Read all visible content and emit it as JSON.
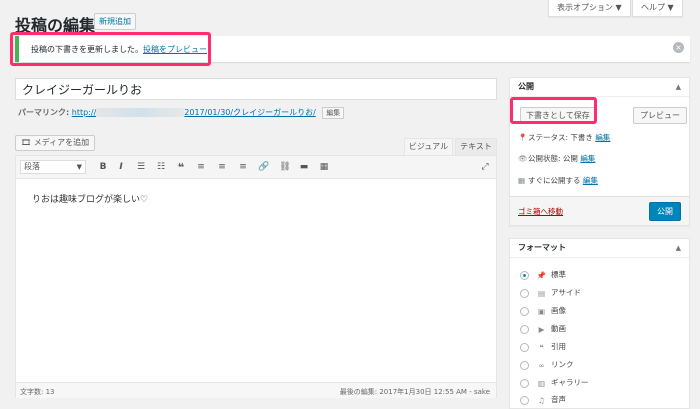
{
  "header": {
    "title": "投稿の編集",
    "new_button": "新規追加",
    "screen_options": "表示オプション ▼",
    "help": "ヘルプ ▼"
  },
  "notice": {
    "text": "投稿の下書きを更新しました。",
    "link": "投稿をプレビュー",
    "close": "×"
  },
  "post": {
    "title": "クレイジーガールりお",
    "permalink_label": "パーマリンク:",
    "permalink_prefix": "http://",
    "permalink_suffix": "2017/01/30/クレイジーガールりお/",
    "permalink_edit": "編集"
  },
  "editor": {
    "media_button": "メディアを追加",
    "tab_visual": "ビジュアル",
    "tab_text": "テキスト",
    "format_select": "段落",
    "content": "りおは趣味ブログが楽しい♡",
    "word_count": "文字数: 13",
    "last_edit": "最後の編集: 2017年1月30日 12:55 AM - sake",
    "toolbar_icons": [
      "bold-icon",
      "italic-icon",
      "bulleted-list-icon",
      "numbered-list-icon",
      "blockquote-icon",
      "align-left-icon",
      "align-center-icon",
      "align-right-icon",
      "link-icon",
      "unlink-icon",
      "read-more-icon",
      "toolbar-toggle-icon"
    ]
  },
  "publish": {
    "title": "公開",
    "save_draft": "下書きとして保存",
    "preview": "プレビュー",
    "status_label": "ステータス: 下書き",
    "status_edit": "編集",
    "visibility_label": "公開状態: 公開",
    "visibility_edit": "編集",
    "schedule_label": "すぐに公開する",
    "schedule_edit": "編集",
    "trash": "ゴミ箱へ移動",
    "publish_button": "公開"
  },
  "format_box": {
    "title": "フォーマット",
    "items": [
      {
        "label": "標準",
        "icon": "pin-icon",
        "checked": true
      },
      {
        "label": "アサイド",
        "icon": "aside-icon",
        "checked": false
      },
      {
        "label": "画像",
        "icon": "image-icon",
        "checked": false
      },
      {
        "label": "動画",
        "icon": "video-icon",
        "checked": false
      },
      {
        "label": "引用",
        "icon": "quote-icon",
        "checked": false
      },
      {
        "label": "リンク",
        "icon": "link-icon",
        "checked": false
      },
      {
        "label": "ギャラリー",
        "icon": "gallery-icon",
        "checked": false
      },
      {
        "label": "音声",
        "icon": "audio-icon",
        "checked": false
      }
    ]
  },
  "colors": {
    "link": "#0073aa",
    "primary_button": "#0085ba",
    "highlight": "#ff2d6f",
    "trash": "#aa0000"
  }
}
